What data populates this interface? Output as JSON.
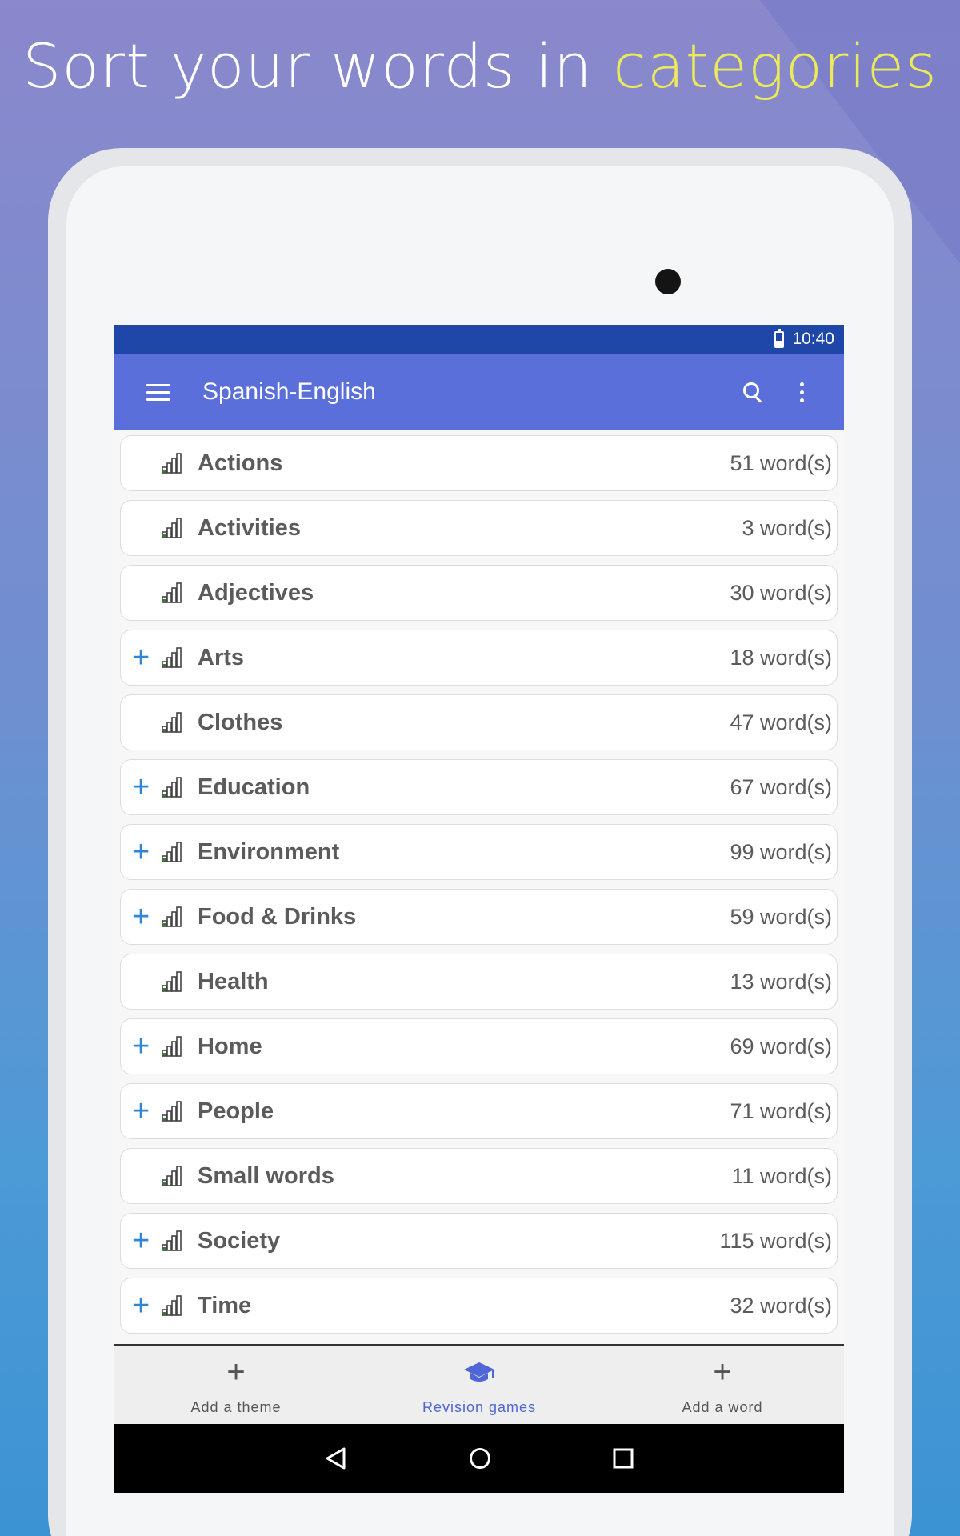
{
  "headline": {
    "text_before": "Sort your words in ",
    "accent_text": "categories",
    "accent_color": "#ece95a"
  },
  "status_bar": {
    "time": "10:40"
  },
  "toolbar": {
    "menu_icon": "hamburger-menu-icon",
    "title": "Spanish-English",
    "search_icon": "search-icon",
    "overflow_icon": "more-vert-icon"
  },
  "categories": [
    {
      "label": "Actions",
      "count": "51 word(s)",
      "has_sub": false
    },
    {
      "label": "Activities",
      "count": "3 word(s)",
      "has_sub": false
    },
    {
      "label": "Adjectives",
      "count": "30 word(s)",
      "has_sub": false
    },
    {
      "label": "Arts",
      "count": "18 word(s)",
      "has_sub": true
    },
    {
      "label": "Clothes",
      "count": "47 word(s)",
      "has_sub": false
    },
    {
      "label": "Education",
      "count": "67 word(s)",
      "has_sub": true
    },
    {
      "label": "Environment",
      "count": "99 word(s)",
      "has_sub": true
    },
    {
      "label": "Food & Drinks",
      "count": "59 word(s)",
      "has_sub": true
    },
    {
      "label": "Health",
      "count": "13 word(s)",
      "has_sub": false
    },
    {
      "label": "Home",
      "count": "69 word(s)",
      "has_sub": true
    },
    {
      "label": "People",
      "count": "71 word(s)",
      "has_sub": true
    },
    {
      "label": "Small words",
      "count": "11 word(s)",
      "has_sub": false
    },
    {
      "label": "Society",
      "count": "115 word(s)",
      "has_sub": true
    },
    {
      "label": "Time",
      "count": "32 word(s)",
      "has_sub": true
    }
  ],
  "bottom_nav": {
    "add_theme": "Add a theme",
    "revision_games": "Revision games",
    "add_word": "Add a word",
    "active_color": "#4e66d6"
  },
  "colors": {
    "status_bar": "#1f47a7",
    "toolbar": "#5b6fdb",
    "expand_plus": "#2f86d6"
  }
}
